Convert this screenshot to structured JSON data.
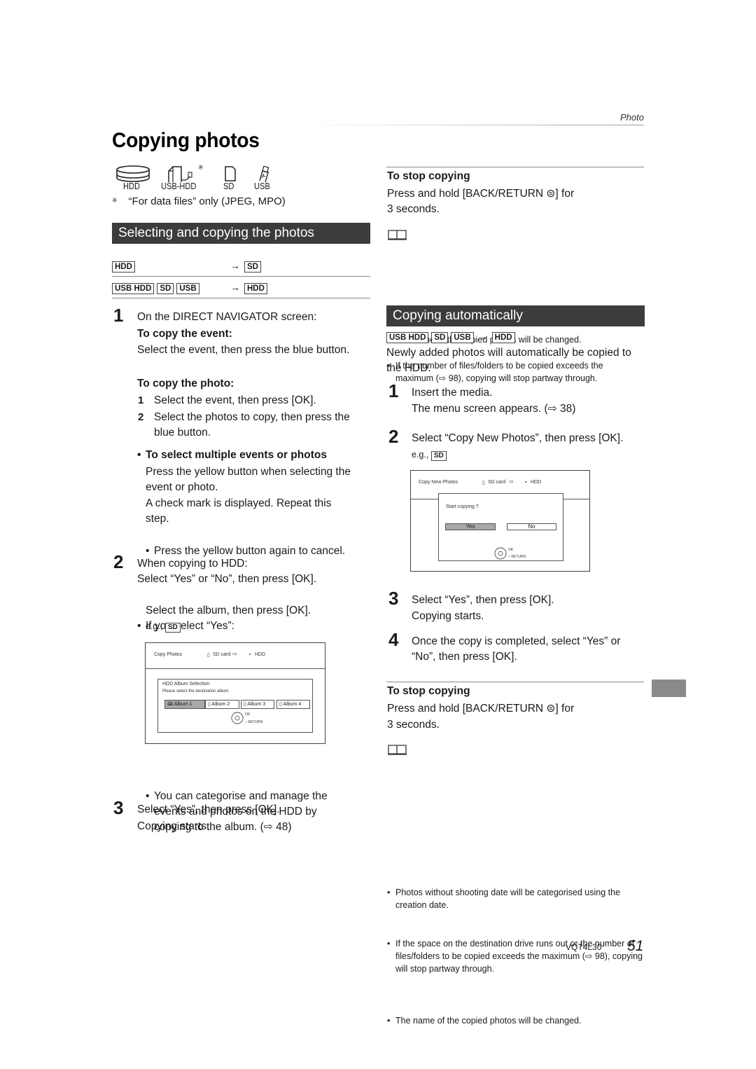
{
  "header": {
    "section_label": "Photo",
    "page_title": "Copying photos"
  },
  "media_icons": [
    {
      "icon": "hdd-icon",
      "label": "HDD"
    },
    {
      "icon": "usb-hdd-icon",
      "label": "USB-HDD",
      "asterisk": "※"
    },
    {
      "icon": "sd-card-icon",
      "label": "SD"
    },
    {
      "icon": "usb-stick-icon",
      "label": "USB"
    }
  ],
  "footnote": {
    "mark": "※",
    "text": "“For data files” only (JPEG, MPO)"
  },
  "left": {
    "banner": "Selecting and copying the photos",
    "routes": [
      {
        "sources": [
          "HDD"
        ],
        "arrow": "→",
        "dest": "SD"
      },
      {
        "sources": [
          "USB HDD",
          "SD",
          "USB"
        ],
        "arrow": "→",
        "dest": "HDD"
      }
    ],
    "step1": {
      "num": "1",
      "intro": "On the DIRECT NAVIGATOR screen:",
      "event_heading": "To copy the event:",
      "event_text": "Select the event, then press the blue button.",
      "photo_heading": "To copy the photo:",
      "photo_steps": [
        {
          "num": "1",
          "text": "Select the event, then press [OK]."
        },
        {
          "num": "2",
          "text": "Select the photos to copy, then press the blue button."
        }
      ],
      "multi_heading": "To select multiple events or photos",
      "multi_text1": "Press the yellow button when selecting the event or photo.",
      "multi_text2": "A check mark is displayed. Repeat this step.",
      "multi_bullet": "Press the yellow button again to cancel."
    },
    "step2": {
      "num": "2",
      "line1": "When copying to HDD:",
      "line2": "Select “Yes” or “No”, then press [OK].",
      "bullet": "If you select “Yes”:",
      "bullet_text": "Select the album, then press [OK].",
      "eg_label": "e.g.,",
      "eg_chip": "SD"
    },
    "screen": {
      "title": "Copy Photos",
      "source": "SD card",
      "dest": "HDD",
      "dialog_title": "HDD Album Selection",
      "dialog_text": "Please select the destination album.",
      "albums": [
        {
          "label": "Album 1",
          "selected": true
        },
        {
          "label": "Album 2",
          "selected": false
        },
        {
          "label": "Album 3",
          "selected": false
        },
        {
          "label": "Album 4",
          "selected": false
        }
      ],
      "ok_label": "OK",
      "return_label": "RETURN"
    },
    "after_screen_bullet": "You can categorise and manage the events and photos on the HDD by copying to the album. (⇨ 48)",
    "step3": {
      "num": "3",
      "line1": "Select “Yes”, then press [OK].",
      "line2": "Copying starts."
    }
  },
  "right": {
    "stop1": {
      "heading": "To stop copying",
      "text1": "Press and hold [BACK/RETURN ⊜] for",
      "text2": "3 seconds.",
      "notes": [
        "The name of the copied photos will be changed.",
        "If the number of files/folders to be copied exceeds the maximum (⇨ 98), copying will stop partway through."
      ]
    },
    "banner": "Copying automatically",
    "route": {
      "sources": [
        "USB HDD",
        "SD",
        "USB"
      ],
      "arrow": "→",
      "dest": "HDD"
    },
    "intro": "Newly added photos will automatically be copied to the HDD.",
    "step1": {
      "num": "1",
      "line1": "Insert the media.",
      "line2": "The menu screen appears. (⇨ 38)"
    },
    "step2": {
      "num": "2",
      "line1": "Select “Copy New Photos”, then press [OK].",
      "eg_label": "e.g.,",
      "eg_chip": "SD"
    },
    "screen": {
      "title": "Copy New Photos",
      "source": "SD card",
      "dest": "HDD",
      "prompt": "Start copying ?",
      "yes": "Yes",
      "no": "No",
      "selected": "Yes",
      "ok_label": "OK",
      "return_label": "RETURN"
    },
    "step3": {
      "num": "3",
      "line1": "Select “Yes”, then press [OK].",
      "line2": "Copying starts."
    },
    "step4": {
      "num": "4",
      "line1": "Once the copy is completed, select “Yes” or",
      "line2": "“No”, then press [OK]."
    },
    "stop2": {
      "heading": "To stop copying",
      "text1": "Press and hold [BACK/RETURN ⊜] for",
      "text2": "3 seconds.",
      "notes": [
        "Photos without shooting date will be categorised using the creation date.",
        "If the space on the destination drive runs out or the number of files/folders to be copied exceeds the maximum (⇨ 98), copying will stop partway through.",
        "The name of the copied photos will be changed."
      ]
    }
  },
  "footer": {
    "code": "VQT4L30",
    "page": "51"
  },
  "colors": {
    "banner_bg": "#3c3c3c",
    "banner_text": "#ffffff",
    "side_tab": "#8a8a8a",
    "selected_btn": "#a8a8a8"
  }
}
